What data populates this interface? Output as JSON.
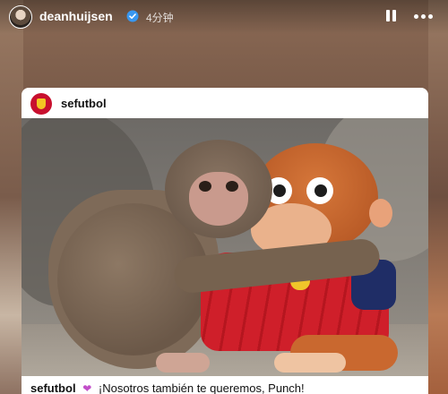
{
  "story": {
    "username": "deanhuijsen",
    "time_ago": "4分钟"
  },
  "post": {
    "username": "sefutbol",
    "caption_user": "sefutbol",
    "caption_text": "¡Nosotros también te queremos, Punch!"
  },
  "icons": {
    "verified": "verified-badge-icon",
    "pause": "pause-icon",
    "more": "more-options-icon",
    "heart": "purple-heart-icon"
  },
  "colors": {
    "verified_blue": "#3897f0",
    "brand_red": "#c8102e",
    "heart_purple": "#c24fc9"
  }
}
